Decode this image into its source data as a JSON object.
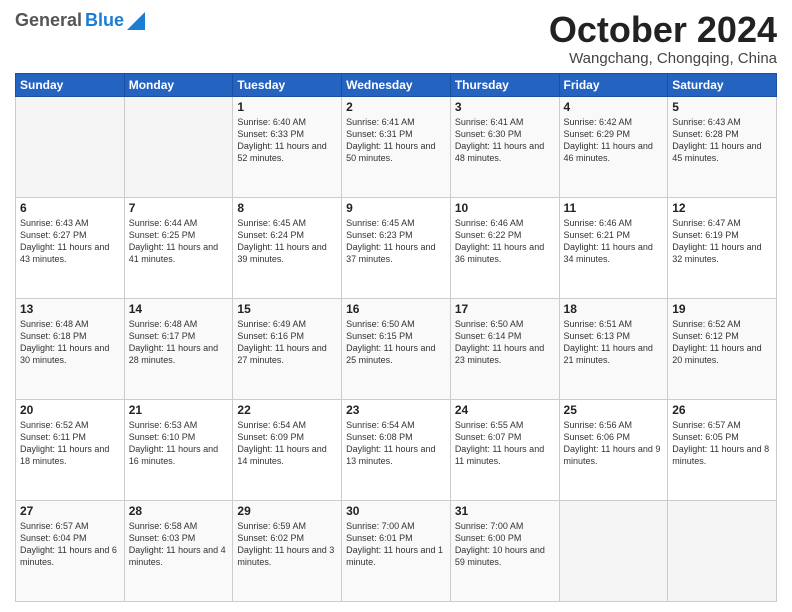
{
  "header": {
    "logo": {
      "general": "General",
      "blue": "Blue"
    },
    "title": "October 2024",
    "location": "Wangchang, Chongqing, China"
  },
  "days_of_week": [
    "Sunday",
    "Monday",
    "Tuesday",
    "Wednesday",
    "Thursday",
    "Friday",
    "Saturday"
  ],
  "weeks": [
    [
      {
        "day": "",
        "info": ""
      },
      {
        "day": "",
        "info": ""
      },
      {
        "day": "1",
        "info": "Sunrise: 6:40 AM\nSunset: 6:33 PM\nDaylight: 11 hours and 52 minutes."
      },
      {
        "day": "2",
        "info": "Sunrise: 6:41 AM\nSunset: 6:31 PM\nDaylight: 11 hours and 50 minutes."
      },
      {
        "day": "3",
        "info": "Sunrise: 6:41 AM\nSunset: 6:30 PM\nDaylight: 11 hours and 48 minutes."
      },
      {
        "day": "4",
        "info": "Sunrise: 6:42 AM\nSunset: 6:29 PM\nDaylight: 11 hours and 46 minutes."
      },
      {
        "day": "5",
        "info": "Sunrise: 6:43 AM\nSunset: 6:28 PM\nDaylight: 11 hours and 45 minutes."
      }
    ],
    [
      {
        "day": "6",
        "info": "Sunrise: 6:43 AM\nSunset: 6:27 PM\nDaylight: 11 hours and 43 minutes."
      },
      {
        "day": "7",
        "info": "Sunrise: 6:44 AM\nSunset: 6:25 PM\nDaylight: 11 hours and 41 minutes."
      },
      {
        "day": "8",
        "info": "Sunrise: 6:45 AM\nSunset: 6:24 PM\nDaylight: 11 hours and 39 minutes."
      },
      {
        "day": "9",
        "info": "Sunrise: 6:45 AM\nSunset: 6:23 PM\nDaylight: 11 hours and 37 minutes."
      },
      {
        "day": "10",
        "info": "Sunrise: 6:46 AM\nSunset: 6:22 PM\nDaylight: 11 hours and 36 minutes."
      },
      {
        "day": "11",
        "info": "Sunrise: 6:46 AM\nSunset: 6:21 PM\nDaylight: 11 hours and 34 minutes."
      },
      {
        "day": "12",
        "info": "Sunrise: 6:47 AM\nSunset: 6:19 PM\nDaylight: 11 hours and 32 minutes."
      }
    ],
    [
      {
        "day": "13",
        "info": "Sunrise: 6:48 AM\nSunset: 6:18 PM\nDaylight: 11 hours and 30 minutes."
      },
      {
        "day": "14",
        "info": "Sunrise: 6:48 AM\nSunset: 6:17 PM\nDaylight: 11 hours and 28 minutes."
      },
      {
        "day": "15",
        "info": "Sunrise: 6:49 AM\nSunset: 6:16 PM\nDaylight: 11 hours and 27 minutes."
      },
      {
        "day": "16",
        "info": "Sunrise: 6:50 AM\nSunset: 6:15 PM\nDaylight: 11 hours and 25 minutes."
      },
      {
        "day": "17",
        "info": "Sunrise: 6:50 AM\nSunset: 6:14 PM\nDaylight: 11 hours and 23 minutes."
      },
      {
        "day": "18",
        "info": "Sunrise: 6:51 AM\nSunset: 6:13 PM\nDaylight: 11 hours and 21 minutes."
      },
      {
        "day": "19",
        "info": "Sunrise: 6:52 AM\nSunset: 6:12 PM\nDaylight: 11 hours and 20 minutes."
      }
    ],
    [
      {
        "day": "20",
        "info": "Sunrise: 6:52 AM\nSunset: 6:11 PM\nDaylight: 11 hours and 18 minutes."
      },
      {
        "day": "21",
        "info": "Sunrise: 6:53 AM\nSunset: 6:10 PM\nDaylight: 11 hours and 16 minutes."
      },
      {
        "day": "22",
        "info": "Sunrise: 6:54 AM\nSunset: 6:09 PM\nDaylight: 11 hours and 14 minutes."
      },
      {
        "day": "23",
        "info": "Sunrise: 6:54 AM\nSunset: 6:08 PM\nDaylight: 11 hours and 13 minutes."
      },
      {
        "day": "24",
        "info": "Sunrise: 6:55 AM\nSunset: 6:07 PM\nDaylight: 11 hours and 11 minutes."
      },
      {
        "day": "25",
        "info": "Sunrise: 6:56 AM\nSunset: 6:06 PM\nDaylight: 11 hours and 9 minutes."
      },
      {
        "day": "26",
        "info": "Sunrise: 6:57 AM\nSunset: 6:05 PM\nDaylight: 11 hours and 8 minutes."
      }
    ],
    [
      {
        "day": "27",
        "info": "Sunrise: 6:57 AM\nSunset: 6:04 PM\nDaylight: 11 hours and 6 minutes."
      },
      {
        "day": "28",
        "info": "Sunrise: 6:58 AM\nSunset: 6:03 PM\nDaylight: 11 hours and 4 minutes."
      },
      {
        "day": "29",
        "info": "Sunrise: 6:59 AM\nSunset: 6:02 PM\nDaylight: 11 hours and 3 minutes."
      },
      {
        "day": "30",
        "info": "Sunrise: 7:00 AM\nSunset: 6:01 PM\nDaylight: 11 hours and 1 minute."
      },
      {
        "day": "31",
        "info": "Sunrise: 7:00 AM\nSunset: 6:00 PM\nDaylight: 10 hours and 59 minutes."
      },
      {
        "day": "",
        "info": ""
      },
      {
        "day": "",
        "info": ""
      }
    ]
  ]
}
